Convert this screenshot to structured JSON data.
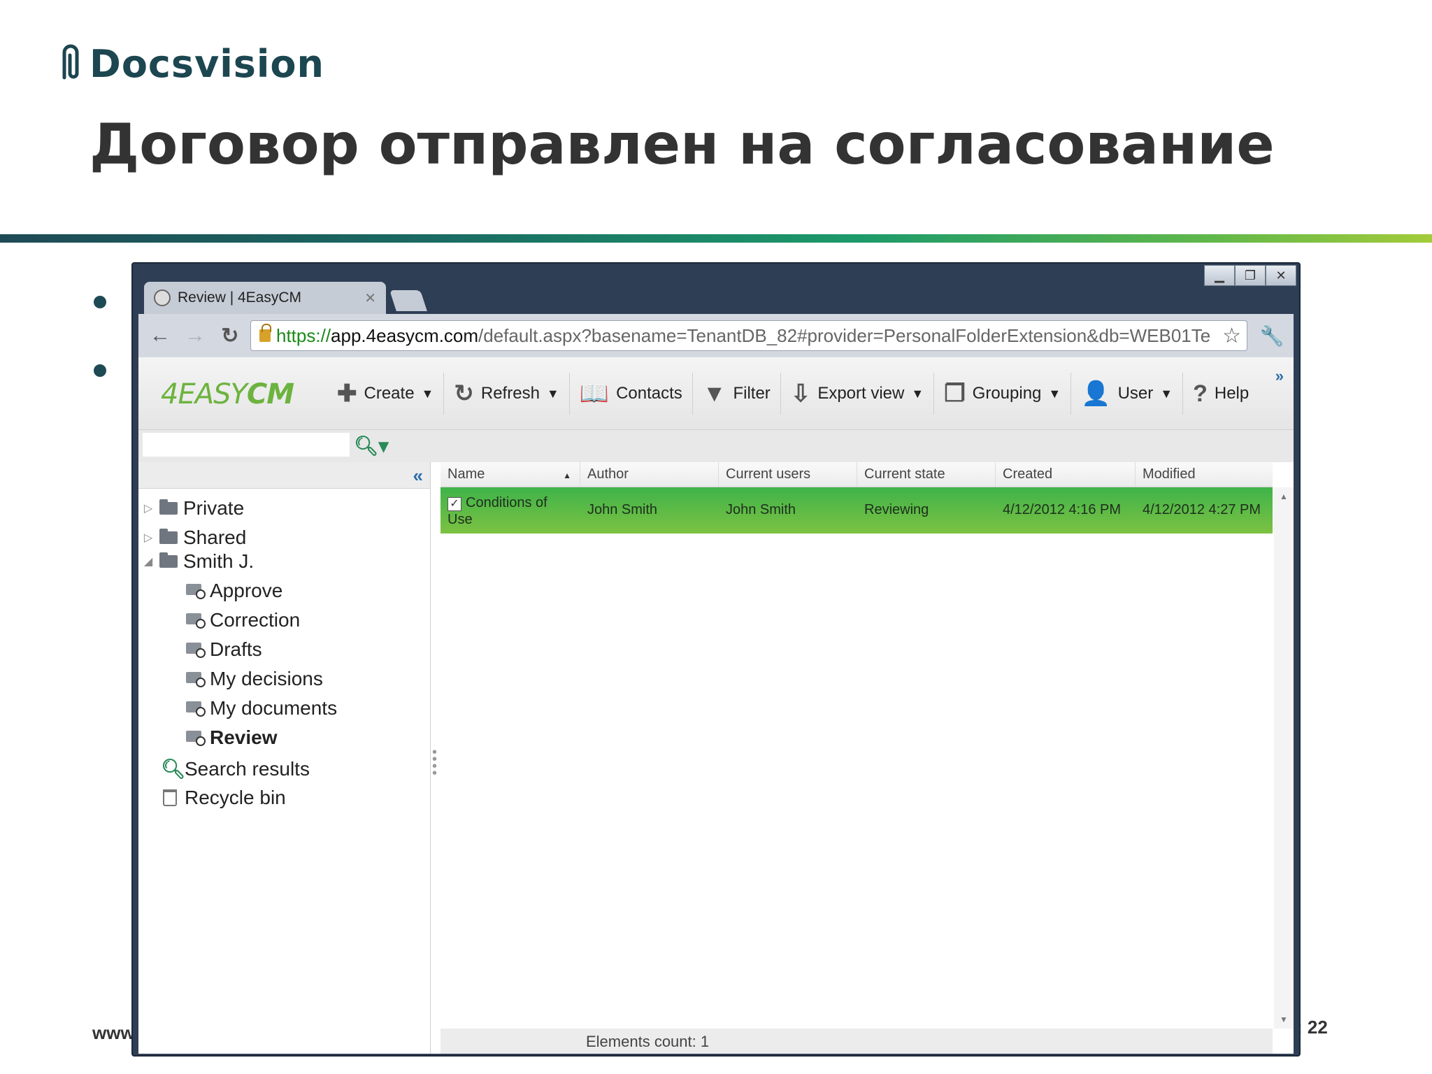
{
  "slide": {
    "logo_text": "Docsvision",
    "title": "Договор отправлен на согласование",
    "footer_left": "www",
    "footer_right": ": 22"
  },
  "browser": {
    "tab_title": "Review | 4EasyCM",
    "url_scheme": "https://",
    "url_host": "app.4easycm.com",
    "url_path": "/default.aspx?basename=TenantDB_82#provider=PersonalFolderExtension&db=WEB01Te"
  },
  "app": {
    "brand_light": "4EASY",
    "brand_bold": "CM",
    "toolbar": [
      {
        "label": "Create",
        "icon": "plus-icon",
        "glyph": "✚",
        "dropdown": true
      },
      {
        "label": "Refresh",
        "icon": "refresh-icon",
        "glyph": "↻",
        "dropdown": true
      },
      {
        "label": "Contacts",
        "icon": "book-icon",
        "glyph": "📖",
        "dropdown": false
      },
      {
        "label": "Filter",
        "icon": "filter-icon",
        "glyph": "▼",
        "dropdown": false
      },
      {
        "label": "Export view",
        "icon": "export-icon",
        "glyph": "⇩",
        "dropdown": true
      },
      {
        "label": "Grouping",
        "icon": "grouping-icon",
        "glyph": "❐",
        "dropdown": true
      },
      {
        "label": "User",
        "icon": "user-icon",
        "glyph": "👤",
        "dropdown": true
      },
      {
        "label": "Help",
        "icon": "help-icon",
        "glyph": "?",
        "dropdown": false
      }
    ],
    "search_value": "",
    "tree": {
      "private": "Private",
      "shared": "Shared",
      "smith": "Smith J.",
      "approve": "Approve",
      "correction": "Correction",
      "drafts": "Drafts",
      "my_decisions": "My decisions",
      "my_documents": "My documents",
      "review": "Review",
      "search_results": "Search results",
      "recycle_bin": "Recycle bin"
    },
    "grid": {
      "columns": [
        "Name",
        "Author",
        "Current users",
        "Current state",
        "Created",
        "Modified"
      ],
      "rows": [
        {
          "name": "Conditions of Use",
          "author": "John Smith",
          "current_users": "John Smith",
          "current_state": "Reviewing",
          "created": "4/12/2012 4:16 PM",
          "modified": "4/12/2012 4:27 PM"
        }
      ],
      "status": "Elements count: 1"
    }
  },
  "colors": {
    "row_highlight": "#5cb946",
    "brand_green": "#6db33f",
    "window_frame": "#2e3e55"
  }
}
